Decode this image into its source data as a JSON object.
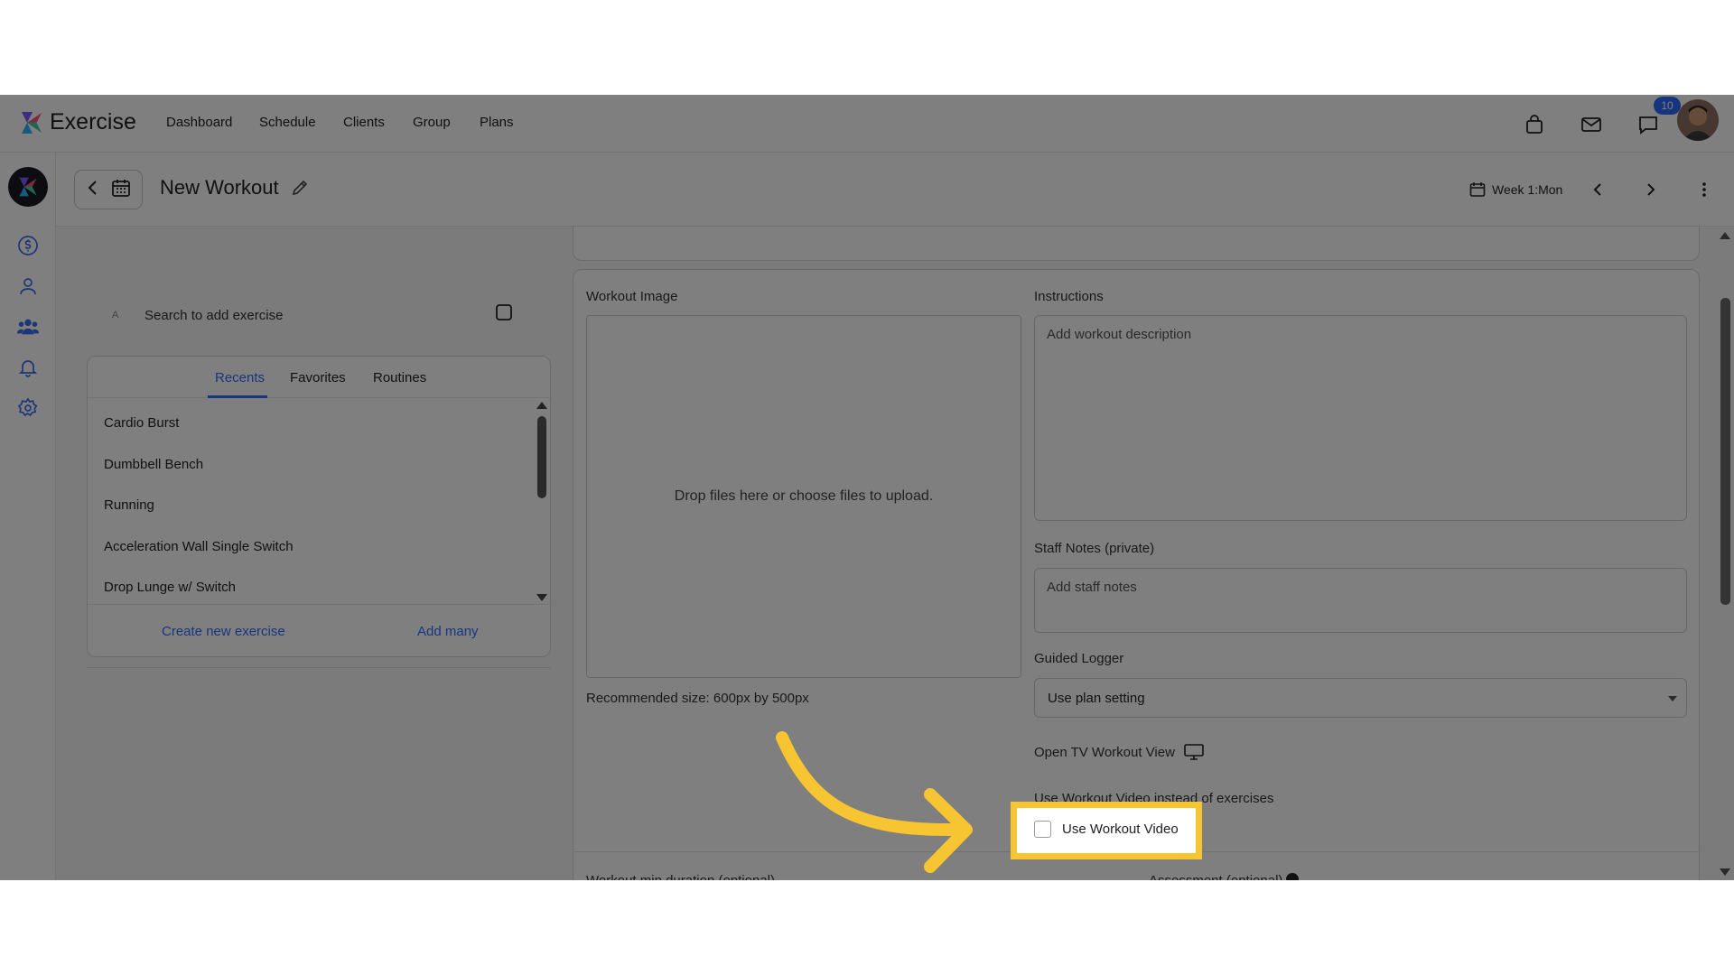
{
  "app": {
    "brand": "Exercise",
    "nav": [
      "Dashboard",
      "Schedule",
      "Clients",
      "Group",
      "Plans"
    ],
    "notification_count": "10"
  },
  "subheader": {
    "title": "New Workout",
    "week_label": "Week 1:Mon"
  },
  "exercise_panel": {
    "search_letter": "A",
    "search_placeholder": "Search to add exercise",
    "tabs": [
      "Recents",
      "Favorites",
      "Routines"
    ],
    "active_tab": "Recents",
    "items": [
      "Cardio Burst",
      "Dumbbell Bench",
      "Running",
      "Acceleration Wall Single Switch",
      "Drop Lunge w/ Switch"
    ],
    "create_label": "Create new exercise",
    "add_many_label": "Add many"
  },
  "workout_form": {
    "image_label": "Workout Image",
    "dropzone_text": "Drop files here or choose files to upload.",
    "recommended_size": "Recommended size: 600px by 500px",
    "instructions_label": "Instructions",
    "instructions_placeholder": "Add workout description",
    "staff_notes_label": "Staff Notes (private)",
    "staff_notes_placeholder": "Add staff notes",
    "guided_logger_label": "Guided Logger",
    "guided_logger_value": "Use plan setting",
    "tv_view_label": "Open TV Workout View",
    "video_question": "Use Workout Video instead of exercises",
    "video_checkbox_label": "Use Workout Video",
    "video_checkbox_checked": false,
    "cut_left": "Workout min duration (optional)",
    "cut_right": "Assessment (optional)"
  },
  "colors": {
    "accent": "#2f6bff",
    "highlight": "#f7c531"
  }
}
